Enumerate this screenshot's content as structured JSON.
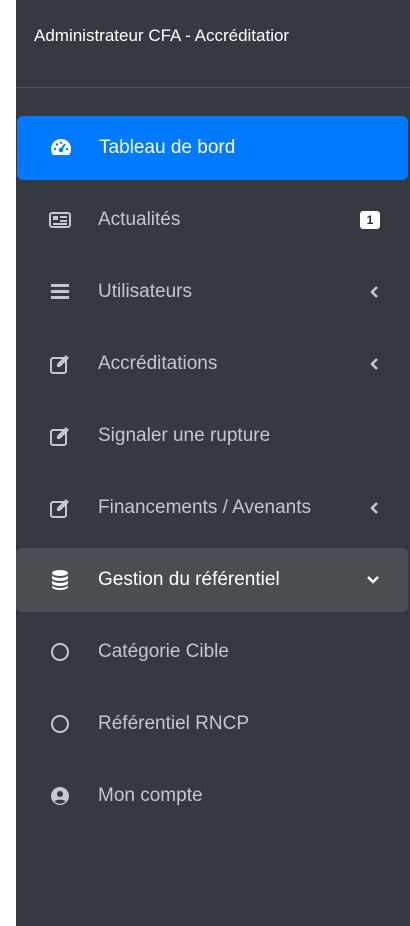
{
  "brand": {
    "title": "Administrateur CFA - Accréditatior"
  },
  "nav": {
    "items": [
      {
        "label": "Tableau de bord",
        "icon": "dashboard-gauge-icon"
      },
      {
        "label": "Actualités",
        "icon": "newspaper-icon",
        "badge": "1"
      },
      {
        "label": "Utilisateurs",
        "icon": "list-icon",
        "chevron": "left"
      },
      {
        "label": "Accréditations",
        "icon": "edit-icon",
        "chevron": "left"
      },
      {
        "label": "Signaler une rupture",
        "icon": "edit-icon"
      },
      {
        "label": "Financements / Avenants",
        "icon": "edit-icon",
        "chevron": "left"
      },
      {
        "label": "Gestion du référentiel",
        "icon": "database-icon",
        "chevron": "down"
      },
      {
        "label": "Catégorie Cible",
        "icon": "circle-outline-icon"
      },
      {
        "label": "Référentiel RNCP",
        "icon": "circle-outline-icon"
      },
      {
        "label": "Mon compte",
        "icon": "user-circle-icon"
      }
    ]
  },
  "colors": {
    "sidebar_bg": "#343a40",
    "active_bg": "#007bff",
    "open_bg": "#494e53",
    "text": "#c2c7d0",
    "text_active": "#ffffff"
  }
}
